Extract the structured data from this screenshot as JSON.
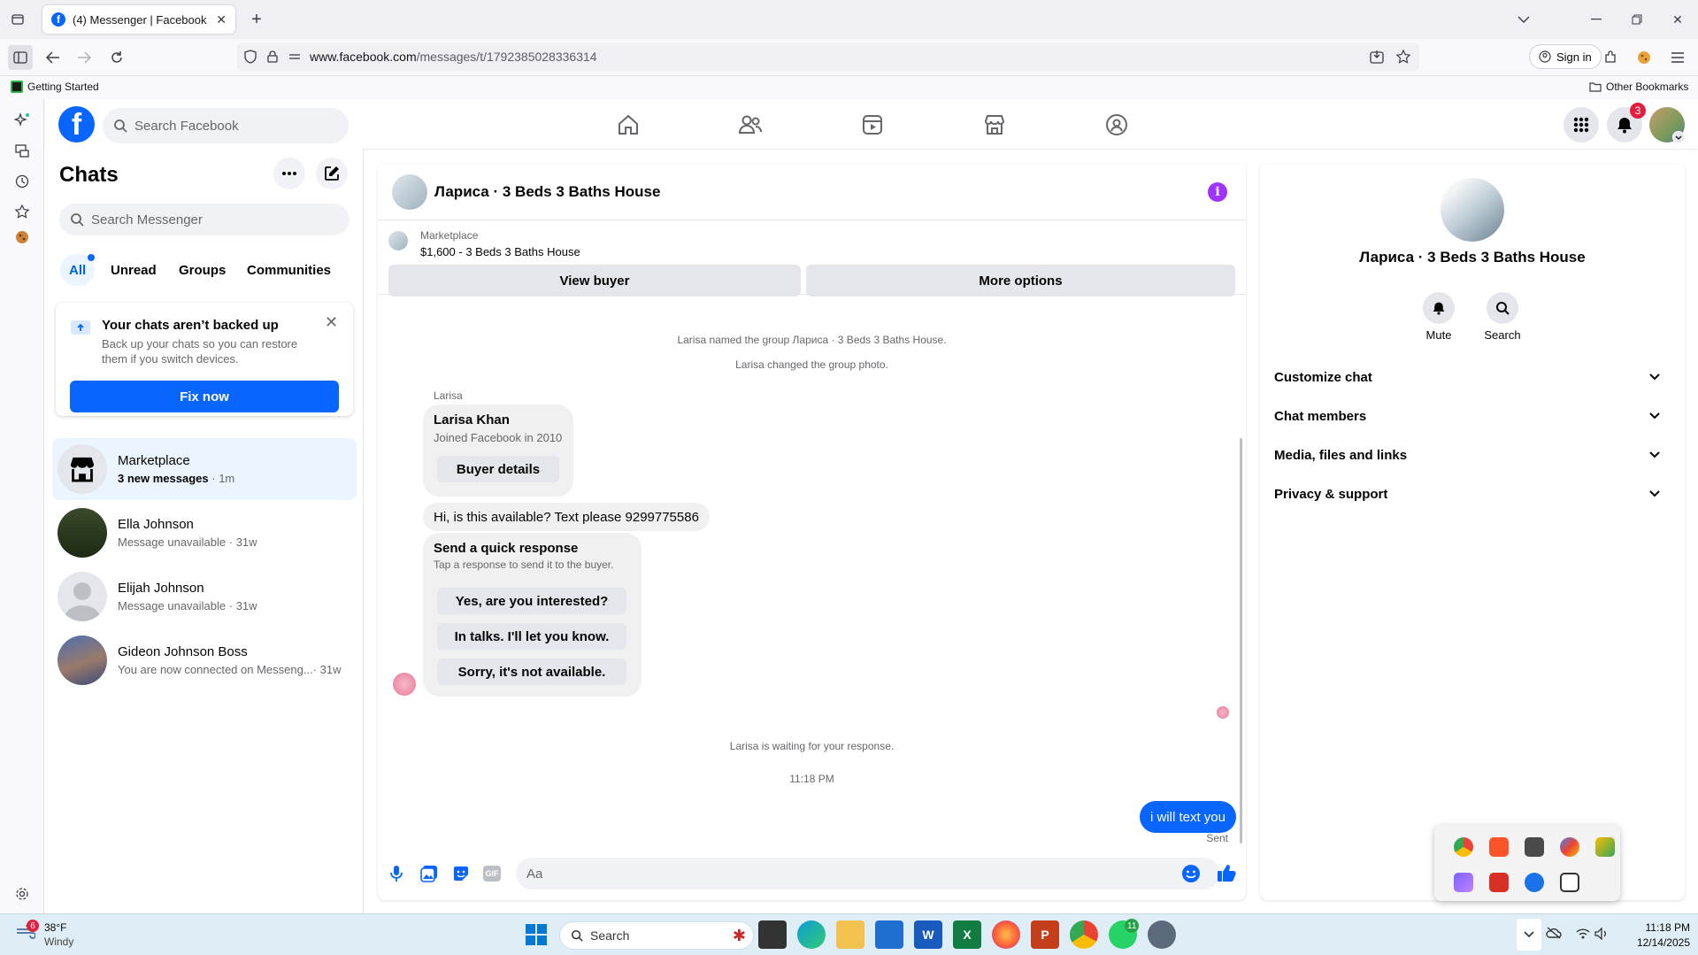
{
  "browser": {
    "tab_title": "(4) Messenger | Facebook",
    "url_host": "www.facebook.com",
    "url_path": "/messages/t/1792385028336314",
    "sign_in": "Sign in",
    "bookmark_getting_started": "Getting Started",
    "bookmark_other": "Other Bookmarks"
  },
  "header": {
    "search_placeholder": "Search Facebook",
    "notification_count": "3"
  },
  "chats": {
    "title": "Chats",
    "search_placeholder": "Search Messenger",
    "filters": [
      "All",
      "Unread",
      "Groups",
      "Communities"
    ],
    "backup": {
      "title": "Your chats aren’t backed up",
      "body": "Back up your chats so you can restore them if you switch devices.",
      "button": "Fix now"
    },
    "items": [
      {
        "name": "Marketplace",
        "sub": "3 new messages",
        "time": "· 1m"
      },
      {
        "name": "Ella Johnson",
        "sub": "Message unavailable",
        "time": "· 31w"
      },
      {
        "name": "Elijah Johnson",
        "sub": "Message unavailable",
        "time": "· 31w"
      },
      {
        "name": "Gideon Johnson Boss",
        "sub": "You are now connected on Messeng...",
        "time": "· 31w"
      }
    ]
  },
  "conversation": {
    "title": "Лариса · 3 Beds 3 Baths House",
    "marketplace_label": "Marketplace",
    "listing": "$1,600 - 3 Beds 3 Baths House",
    "view_buyer": "View buyer",
    "more_options": "More options",
    "sys_named": "Larisa named the group Лариса · 3 Beds 3 Baths House.",
    "sys_photo": "Larisa changed the group photo.",
    "sender_label": "Larisa",
    "profile_name": "Larisa Khan",
    "profile_joined": "Joined Facebook in 2010",
    "buyer_details": "Buyer details",
    "message": "Hi, is this available? Text please 9299775586",
    "quick_title": "Send a quick response",
    "quick_sub": "Tap a response to send it to the buyer.",
    "quick_replies": [
      "Yes, are you interested?",
      "In talks. I'll let you know.",
      "Sorry, it's not available."
    ],
    "waiting": "Larisa is waiting for your response.",
    "time": "11:18 PM",
    "sent_message": "i will text you",
    "sent_status": "Sent",
    "composer_placeholder": "Aa"
  },
  "info": {
    "name": "Лариса · 3 Beds 3 Baths House",
    "mute": "Mute",
    "search": "Search",
    "sections": [
      "Customize chat",
      "Chat members",
      "Media, files and links",
      "Privacy & support"
    ]
  },
  "taskbar": {
    "weather_temp": "38°F",
    "weather_desc": "Windy",
    "weather_badge": "6",
    "search": "Search",
    "time": "11:18 PM",
    "date": "12/14/2025",
    "whatsapp_badge": "11"
  },
  "colors": {
    "fb_blue": "#0866ff",
    "info_purple": "#a033ff",
    "badge_red": "#e41e3f"
  }
}
